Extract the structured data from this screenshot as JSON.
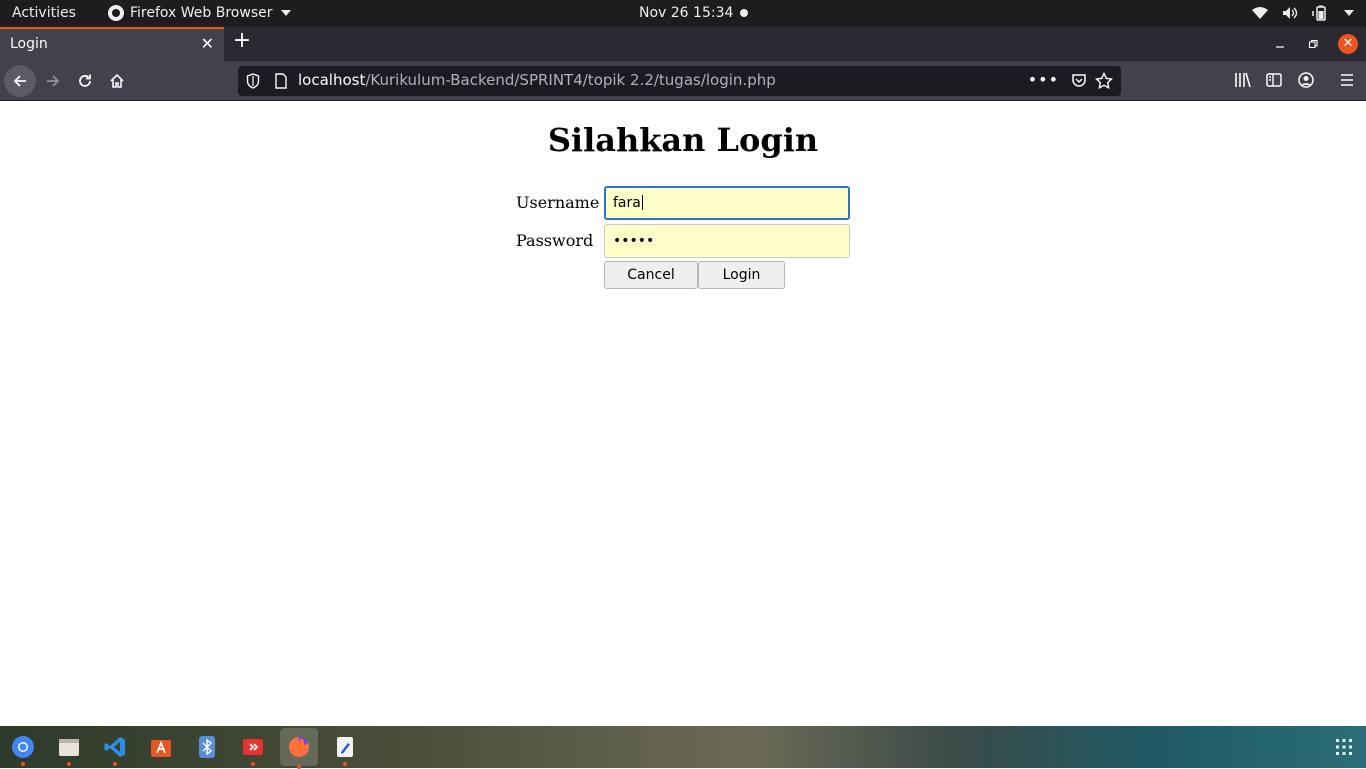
{
  "system_bar": {
    "activities": "Activities",
    "app_name": "Firefox Web Browser",
    "clock": "Nov 26  15:34"
  },
  "browser": {
    "tab_title": "Login",
    "url_host": "localhost",
    "url_path": "/Kurikulum-Backend/SPRINT4/topik 2.2/tugas/login.php",
    "url_more": "•••"
  },
  "page": {
    "heading": "Silahkan Login",
    "username_label": "Username",
    "password_label": "Password",
    "username_value": "fara",
    "password_value": "•••••",
    "cancel_label": "Cancel",
    "login_label": "Login",
    "field_bg": "#ffffc8",
    "focus_color": "#2a74c9"
  },
  "dock": {
    "apps": [
      "chrome-icon",
      "files-icon",
      "vscode-icon",
      "software-center-icon",
      "bluetooth-icon",
      "anydesk-icon",
      "firefox-icon",
      "text-editor-icon",
      "show-apps-icon"
    ]
  },
  "colors": {
    "ubuntu_orange": "#e95420",
    "firefox_tab_accent": "#e66000"
  }
}
